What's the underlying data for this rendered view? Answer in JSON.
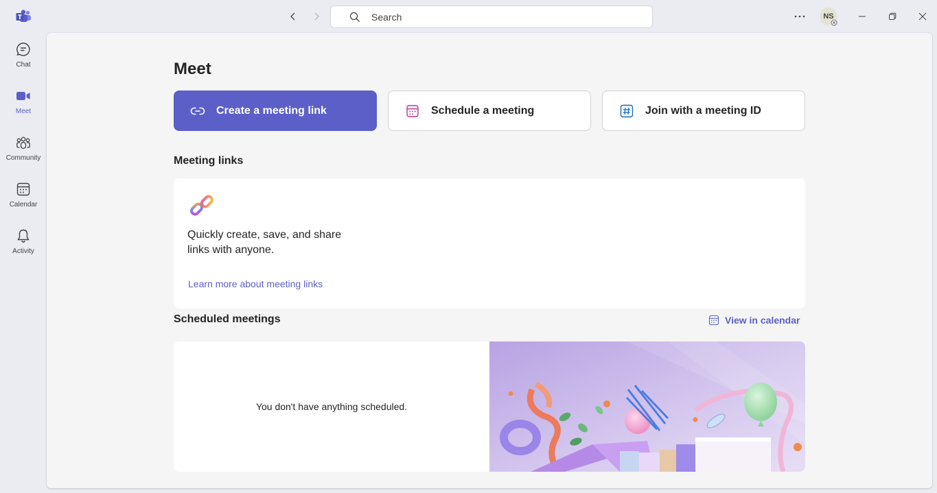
{
  "titlebar": {
    "search_placeholder": "Search",
    "avatar_initials": "NS"
  },
  "rail": {
    "items": [
      {
        "label": "Chat",
        "icon": "chat-icon"
      },
      {
        "label": "Meet",
        "icon": "video-camera-icon",
        "active": true
      },
      {
        "label": "Community",
        "icon": "community-icon"
      },
      {
        "label": "Calendar",
        "icon": "calendar-icon"
      },
      {
        "label": "Activity",
        "icon": "bell-icon"
      }
    ]
  },
  "main": {
    "title": "Meet",
    "actions": [
      {
        "label": "Create a meeting link",
        "icon": "link-icon"
      },
      {
        "label": "Schedule a meeting",
        "icon": "calendar-icon"
      },
      {
        "label": "Join with a meeting ID",
        "icon": "hash-icon"
      }
    ],
    "meeting_links": {
      "title": "Meeting links",
      "description": "Quickly create, save, and share links with anyone.",
      "learn_more": "Learn more about meeting links"
    },
    "scheduled": {
      "title": "Scheduled meetings",
      "view_in_calendar": "View in calendar",
      "empty_text": "You don't have anything scheduled."
    }
  },
  "colors": {
    "accent": "#5b5fc7",
    "background": "#ebebf2",
    "pane": "#f5f5f5"
  }
}
